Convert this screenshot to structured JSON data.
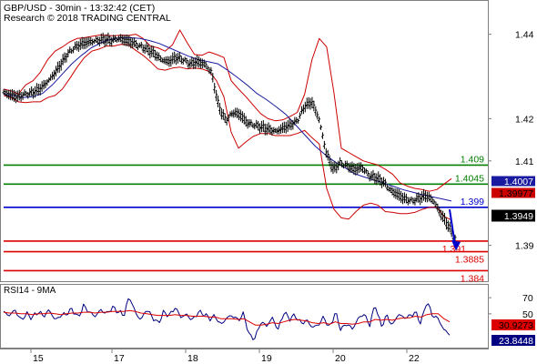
{
  "header": {
    "line1": "GBP/USD - 30min - 13:32:42 (CET)",
    "line2": "Research © 2018 TRADING CENTRAL"
  },
  "colors": {
    "price": "#000000",
    "bollinger": "#cc0000",
    "moving_average": "#1a1aa0",
    "resistance": "#008000",
    "pivot": "#0000cc",
    "support": "#dd0000",
    "current_price_box": "#000000",
    "rsi": "#000080",
    "rsi_ma": "#dd0000"
  },
  "chart_data": [
    {
      "type": "line",
      "panel": "price",
      "x": [
        "15",
        "17",
        "18",
        "19",
        "20",
        "22"
      ],
      "ylim": [
        1.3815,
        1.4479
      ],
      "y_ticks": [
        {
          "value": 1.44,
          "label": "1.44"
        },
        {
          "value": 1.42,
          "label": "1.42"
        },
        {
          "value": 1.41,
          "label": "1.41"
        },
        {
          "value": 1.39,
          "label": "1.39"
        }
      ],
      "series": [
        {
          "role": "price",
          "style": "bars",
          "values": [
            1.4262,
            1.4256,
            1.4252,
            1.4258,
            1.4262,
            1.427,
            1.4285,
            1.4305,
            1.433,
            1.4355,
            1.437,
            1.4378,
            1.4382,
            1.4385,
            1.4388,
            1.4385,
            1.439,
            1.4386,
            1.438,
            1.4372,
            1.4365,
            1.4355,
            1.434,
            1.4335,
            1.4345,
            1.434,
            1.433,
            1.4335,
            1.433,
            1.431,
            1.423,
            1.4195,
            1.4215,
            1.421,
            1.419,
            1.4185,
            1.418,
            1.4175,
            1.417,
            1.4178,
            1.4185,
            1.4195,
            1.423,
            1.424,
            1.42,
            1.412,
            1.408,
            1.4095,
            1.4088,
            1.408,
            1.4085,
            1.4065,
            1.406,
            1.405,
            1.403,
            1.402,
            1.401,
            1.4005,
            1.4012,
            1.4018,
            1.4005,
            1.3975,
            1.3948,
            1.3915
          ]
        },
        {
          "role": "bollinger-upper",
          "values": [
            1.427,
            1.4266,
            1.4258,
            1.428,
            1.429,
            1.431,
            1.434,
            1.436,
            1.437,
            1.4382,
            1.439,
            1.4392,
            1.4395,
            1.4398,
            1.4398,
            1.4396,
            1.4398,
            1.4397,
            1.44,
            1.439,
            1.4372,
            1.4368,
            1.436,
            1.4375,
            1.441,
            1.438,
            1.4352,
            1.435,
            1.4358,
            1.4352,
            1.4345,
            1.429,
            1.427,
            1.4252,
            1.4232,
            1.4212,
            1.42,
            1.4195,
            1.4197,
            1.4205,
            1.4215,
            1.4258,
            1.434,
            1.439,
            1.437,
            1.426,
            1.413,
            1.412,
            1.411,
            1.41,
            1.4095,
            1.409,
            1.408,
            1.4068,
            1.4048,
            1.404,
            1.4035,
            1.4032,
            1.4028,
            1.4032,
            1.4045,
            1.4058
          ]
        },
        {
          "role": "bollinger-lower",
          "values": [
            1.4255,
            1.425,
            1.424,
            1.4238,
            1.424,
            1.424,
            1.425,
            1.4255,
            1.427,
            1.4295,
            1.4322,
            1.4345,
            1.436,
            1.4365,
            1.4372,
            1.4372,
            1.4376,
            1.4375,
            1.4362,
            1.435,
            1.4335,
            1.4318,
            1.4315,
            1.432,
            1.4322,
            1.4318,
            1.432,
            1.4318,
            1.4312,
            1.429,
            1.4252,
            1.4168,
            1.413,
            1.4145,
            1.4158,
            1.4165,
            1.4165,
            1.416,
            1.416,
            1.416,
            1.4165,
            1.4172,
            1.4155,
            1.414,
            1.4035,
            1.3985,
            1.3965,
            1.3962,
            1.398,
            1.3995,
            1.4,
            1.3995,
            1.398,
            1.3978,
            1.3975,
            1.3975,
            1.3978,
            1.3985,
            1.399,
            1.399,
            1.3968,
            1.396
          ]
        },
        {
          "role": "moving-average",
          "values": [
            1.4258,
            1.4255,
            1.425,
            1.4252,
            1.426,
            1.428,
            1.4305,
            1.433,
            1.435,
            1.4368,
            1.438,
            1.4388,
            1.4392,
            1.4392,
            1.439,
            1.4385,
            1.4378,
            1.4368,
            1.4358,
            1.4348,
            1.434,
            1.4335,
            1.433,
            1.4315,
            1.4298,
            1.428,
            1.426,
            1.4245,
            1.4228,
            1.421,
            1.4185,
            1.416,
            1.4135,
            1.4115,
            1.4098,
            1.4085,
            1.407,
            1.4062,
            1.4055,
            1.4048,
            1.404,
            1.4032,
            1.4026,
            1.402,
            1.4015,
            1.401,
            1.4005
          ]
        }
      ],
      "levels": [
        {
          "label": "1.409",
          "value": 1.409,
          "role": "resistance"
        },
        {
          "label": "1.4045",
          "value": 1.4045,
          "role": "resistance"
        },
        {
          "label": "1.399",
          "value": 1.399,
          "role": "pivot"
        },
        {
          "label": "1.391",
          "value": 1.391,
          "role": "support"
        },
        {
          "label": "1.3885",
          "value": 1.3885,
          "role": "support"
        },
        {
          "label": "1.384",
          "value": 1.384,
          "role": "support"
        }
      ],
      "value_badges": [
        {
          "label": "1.4007",
          "value": 1.4007,
          "role": "moving-average"
        },
        {
          "label": "1.39977",
          "value": 1.39977,
          "role": "bollinger"
        },
        {
          "label": "1.3949",
          "value": 1.3949,
          "role": "current-price"
        }
      ]
    },
    {
      "type": "line",
      "panel": "rsi",
      "title": "RSI14 - 9MA",
      "ylim": [
        8,
        86
      ],
      "y_ticks": [
        {
          "value": 70,
          "label": "70"
        },
        {
          "value": 50,
          "label": "50"
        }
      ],
      "series": [
        {
          "role": "rsi",
          "values": [
            52,
            48,
            55,
            42,
            50,
            45,
            53,
            47,
            55,
            42,
            48,
            50,
            56,
            45,
            60,
            52,
            47,
            55,
            50,
            58,
            53,
            48,
            72,
            52,
            42,
            56,
            46,
            38,
            52,
            48,
            58,
            46,
            49,
            42,
            52,
            50,
            44,
            47,
            36,
            45,
            48,
            42,
            50,
            22,
            20,
            40,
            35,
            45,
            30,
            52,
            44,
            48,
            38,
            42,
            33,
            36,
            46,
            32,
            52,
            30,
            38,
            31,
            44,
            50,
            36,
            62,
            34,
            48,
            35,
            50,
            45,
            47,
            52,
            38,
            66,
            48,
            44,
            30,
            25
          ]
        },
        {
          "role": "rsi-ma",
          "values": [
            52,
            51,
            51,
            50,
            50,
            49,
            50,
            50,
            51,
            50,
            49,
            50,
            51,
            51,
            52,
            52,
            51,
            52,
            52,
            53,
            53,
            53,
            54,
            53,
            51,
            50,
            49,
            48,
            48,
            48,
            49,
            48,
            48,
            47,
            47,
            47,
            46,
            46,
            44,
            44,
            44,
            43,
            44,
            40,
            36,
            36,
            37,
            39,
            38,
            40,
            42,
            43,
            42,
            41,
            39,
            38,
            39,
            37,
            40,
            38,
            38,
            37,
            38,
            40,
            40,
            43,
            42,
            43,
            42,
            44,
            45,
            45,
            47,
            46,
            49,
            50,
            50,
            44,
            40
          ]
        }
      ],
      "value_badges": [
        {
          "label": "30.9273",
          "value": 30.9273,
          "role": "rsi-ma"
        },
        {
          "label": "23.8448",
          "value": 23.8448,
          "role": "rsi"
        }
      ]
    }
  ]
}
